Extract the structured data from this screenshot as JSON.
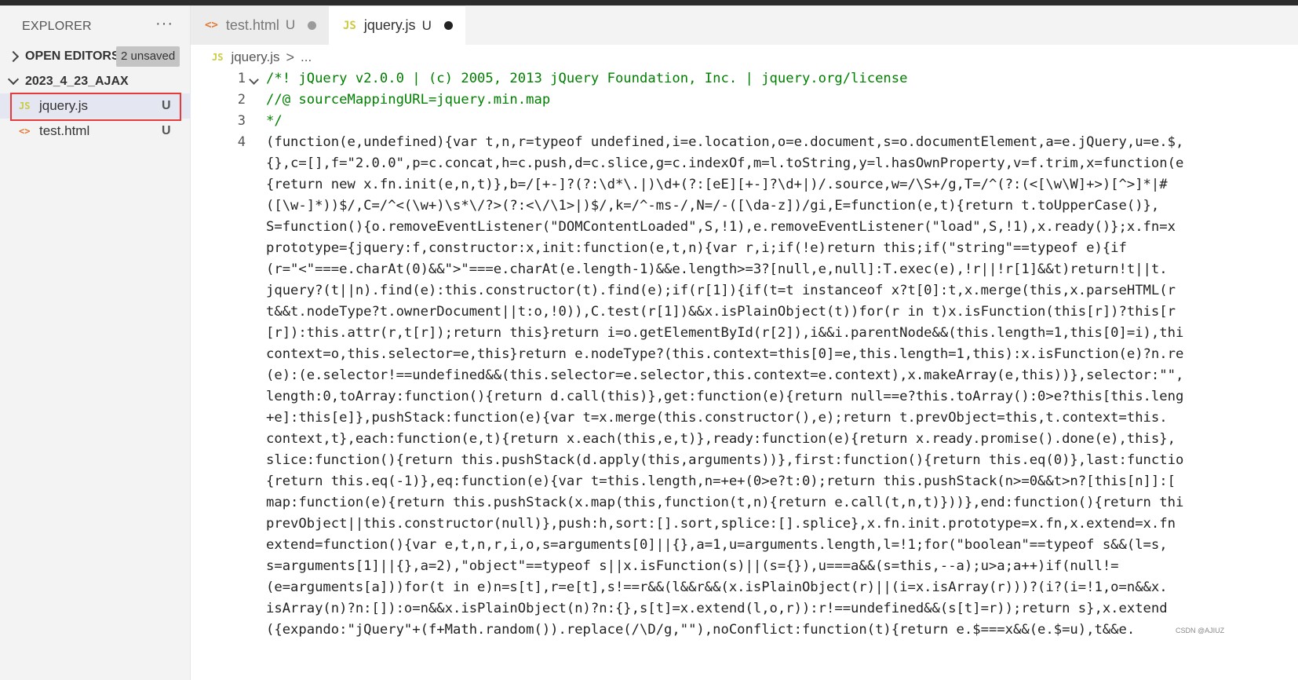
{
  "explorer": {
    "title": "EXPLORER",
    "more": "···",
    "open_editors": {
      "label": "OPEN EDITORS",
      "badge": "2 unsaved"
    },
    "folder": {
      "label": "2023_4_23_AJAX"
    },
    "files": [
      {
        "name": "jquery.js",
        "icon": "JS",
        "status": "U",
        "selected": true
      },
      {
        "name": "test.html",
        "icon": "<>",
        "status": "U",
        "selected": false
      }
    ]
  },
  "tabs": [
    {
      "name": "test.html",
      "icon": "<>",
      "status": "U",
      "active": false
    },
    {
      "name": "jquery.js",
      "icon": "JS",
      "status": "U",
      "active": true
    }
  ],
  "breadcrumb": {
    "icon": "JS",
    "file": "jquery.js",
    "sep": ">",
    "more": "..."
  },
  "editor": {
    "line_numbers": [
      "1",
      "2",
      "3",
      "4"
    ],
    "lines": [
      "/*! jQuery v2.0.0 | (c) 2005, 2013 jQuery Foundation, Inc. | jquery.org/license",
      "//@ sourceMappingURL=jquery.min.map",
      "*/",
      "(function(e,undefined){var t,n,r=typeof undefined,i=e.location,o=e.document,s=o.documentElement,a=e.jQuery,u=e.$,",
      "{},c=[],f=\"2.0.0\",p=c.concat,h=c.push,d=c.slice,g=c.indexOf,m=l.toString,y=l.hasOwnProperty,v=f.trim,x=function(e",
      "{return new x.fn.init(e,n,t)},b=/[+-]?(?:\\d*\\.|)\\d+(?:[eE][+-]?\\d+|)/.source,w=/\\S+/g,T=/^(?:(<[\\w\\W]+>)[^>]*|#",
      "([\\w-]*))$/,C=/^<(\\w+)\\s*\\/?>(?:<\\/\\1>|)$/,k=/^-ms-/,N=/-([\\da-z])/gi,E=function(e,t){return t.toUpperCase()},",
      "S=function(){o.removeEventListener(\"DOMContentLoaded\",S,!1),e.removeEventListener(\"load\",S,!1),x.ready()};x.fn=x",
      "prototype={jquery:f,constructor:x,init:function(e,t,n){var r,i;if(!e)return this;if(\"string\"==typeof e){if",
      "(r=\"<\"===e.charAt(0)&&\">\"===e.charAt(e.length-1)&&e.length>=3?[null,e,null]:T.exec(e),!r||!r[1]&&t)return!t||t.",
      "jquery?(t||n).find(e):this.constructor(t).find(e);if(r[1]){if(t=t instanceof x?t[0]:t,x.merge(this,x.parseHTML(r",
      "t&&t.nodeType?t.ownerDocument||t:o,!0)),C.test(r[1])&&x.isPlainObject(t))for(r in t)x.isFunction(this[r])?this[r",
      "[r]):this.attr(r,t[r]);return this}return i=o.getElementById(r[2]),i&&i.parentNode&&(this.length=1,this[0]=i),thi",
      "context=o,this.selector=e,this}return e.nodeType?(this.context=this[0]=e,this.length=1,this):x.isFunction(e)?n.re",
      "(e):(e.selector!==undefined&&(this.selector=e.selector,this.context=e.context),x.makeArray(e,this))},selector:\"\",",
      "length:0,toArray:function(){return d.call(this)},get:function(e){return null==e?this.toArray():0>e?this[this.leng",
      "+e]:this[e]},pushStack:function(e){var t=x.merge(this.constructor(),e);return t.prevObject=this,t.context=this.",
      "context,t},each:function(e,t){return x.each(this,e,t)},ready:function(e){return x.ready.promise().done(e),this},",
      "slice:function(){return this.pushStack(d.apply(this,arguments))},first:function(){return this.eq(0)},last:functio",
      "{return this.eq(-1)},eq:function(e){var t=this.length,n=+e+(0>e?t:0);return this.pushStack(n>=0&&t>n?[this[n]]:[",
      "map:function(e){return this.pushStack(x.map(this,function(t,n){return e.call(t,n,t)}))},end:function(){return thi",
      "prevObject||this.constructor(null)},push:h,sort:[].sort,splice:[].splice},x.fn.init.prototype=x.fn,x.extend=x.fn",
      "extend=function(){var e,t,n,r,i,o,s=arguments[0]||{},a=1,u=arguments.length,l=!1;for(\"boolean\"==typeof s&&(l=s,",
      "s=arguments[1]||{},a=2),\"object\"==typeof s||x.isFunction(s)||(s={}),u===a&&(s=this,--a);u>a;a++)if(null!=",
      "(e=arguments[a]))for(t in e)n=s[t],r=e[t],s!==r&&(l&&r&&(x.isPlainObject(r)||(i=x.isArray(r)))?(i?(i=!1,o=n&&x.",
      "isArray(n)?n:[]):o=n&&x.isPlainObject(n)?n:{},s[t]=x.extend(l,o,r)):r!==undefined&&(s[t]=r));return s},x.extend",
      "({expando:\"jQuery\"+(f+Math.random()).replace(/\\D/g,\"\"),noConflict:function(t){return e.$===x&&(e.$=u),t&&e."
    ]
  },
  "watermark": "CSDN @AJIUZ",
  "colors": {
    "selection_border": "#e8393b",
    "comment": "#008000",
    "js_icon": "#cbcb41",
    "html_icon": "#e37933"
  }
}
